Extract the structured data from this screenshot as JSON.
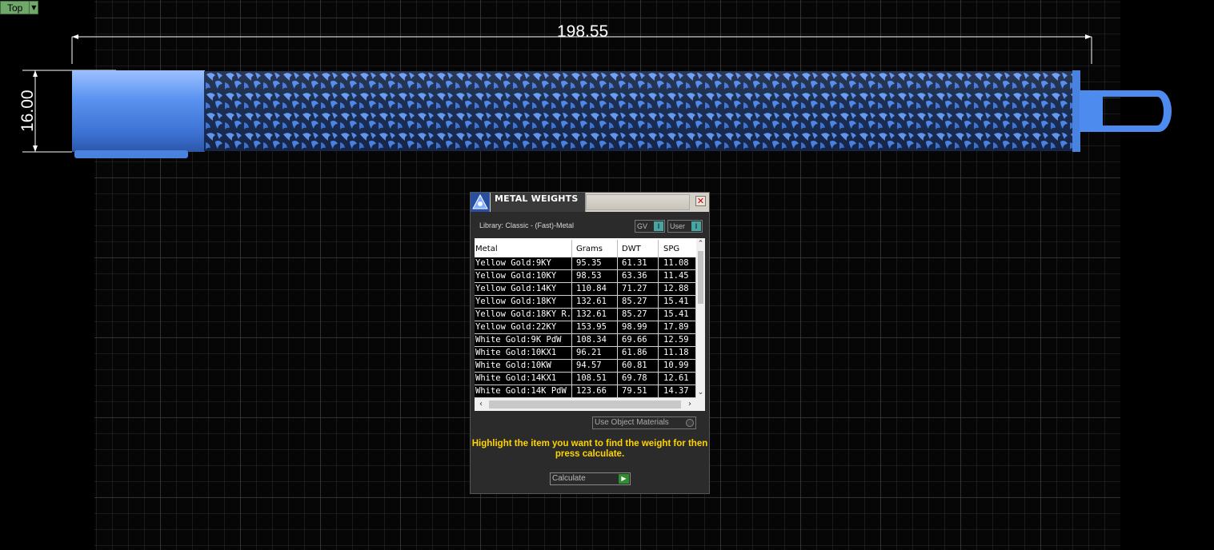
{
  "viewport": {
    "view_name": "Top",
    "view_dropdown_icon": "triangle-down-icon",
    "dimensions": {
      "length": "198.55",
      "height": "16.00"
    },
    "model_color": "#4a86e8"
  },
  "dialog": {
    "title": "METAL WEIGHTS",
    "close_icon": "close-icon",
    "library_label": "Library: Classic - (Fast)-Metal",
    "toggles": [
      {
        "label": "GV"
      },
      {
        "label": "User"
      }
    ],
    "table": {
      "columns": [
        "Metal",
        "Grams",
        "DWT",
        "SPG"
      ],
      "rows": [
        [
          "Yellow Gold:9KY",
          "95.35",
          "61.31",
          "11.08"
        ],
        [
          "Yellow Gold:10KY",
          "98.53",
          "63.36",
          "11.45"
        ],
        [
          "Yellow Gold:14KY",
          "110.84",
          "71.27",
          "12.88"
        ],
        [
          "Yellow Gold:18KY",
          "132.61",
          "85.27",
          "15.41"
        ],
        [
          "Yellow Gold:18KY R...",
          "132.61",
          "85.27",
          "15.41"
        ],
        [
          "Yellow Gold:22KY",
          "153.95",
          "98.99",
          "17.89"
        ],
        [
          "White Gold:9K PdW",
          "108.34",
          "69.66",
          "12.59"
        ],
        [
          "White Gold:10KX1",
          "96.21",
          "61.86",
          "11.18"
        ],
        [
          "White Gold:10KW",
          "94.57",
          "60.81",
          "10.99"
        ],
        [
          "White Gold:14KX1",
          "108.51",
          "69.78",
          "12.61"
        ],
        [
          "White Gold:14K PdW",
          "123.66",
          "79.51",
          "14.37"
        ]
      ]
    },
    "use_object_materials": "Use Object Materials",
    "hint": "Highlight the item you want to find the weight for then press calculate.",
    "calculate_label": "Calculate",
    "accent_yellow": "#ffd400"
  }
}
